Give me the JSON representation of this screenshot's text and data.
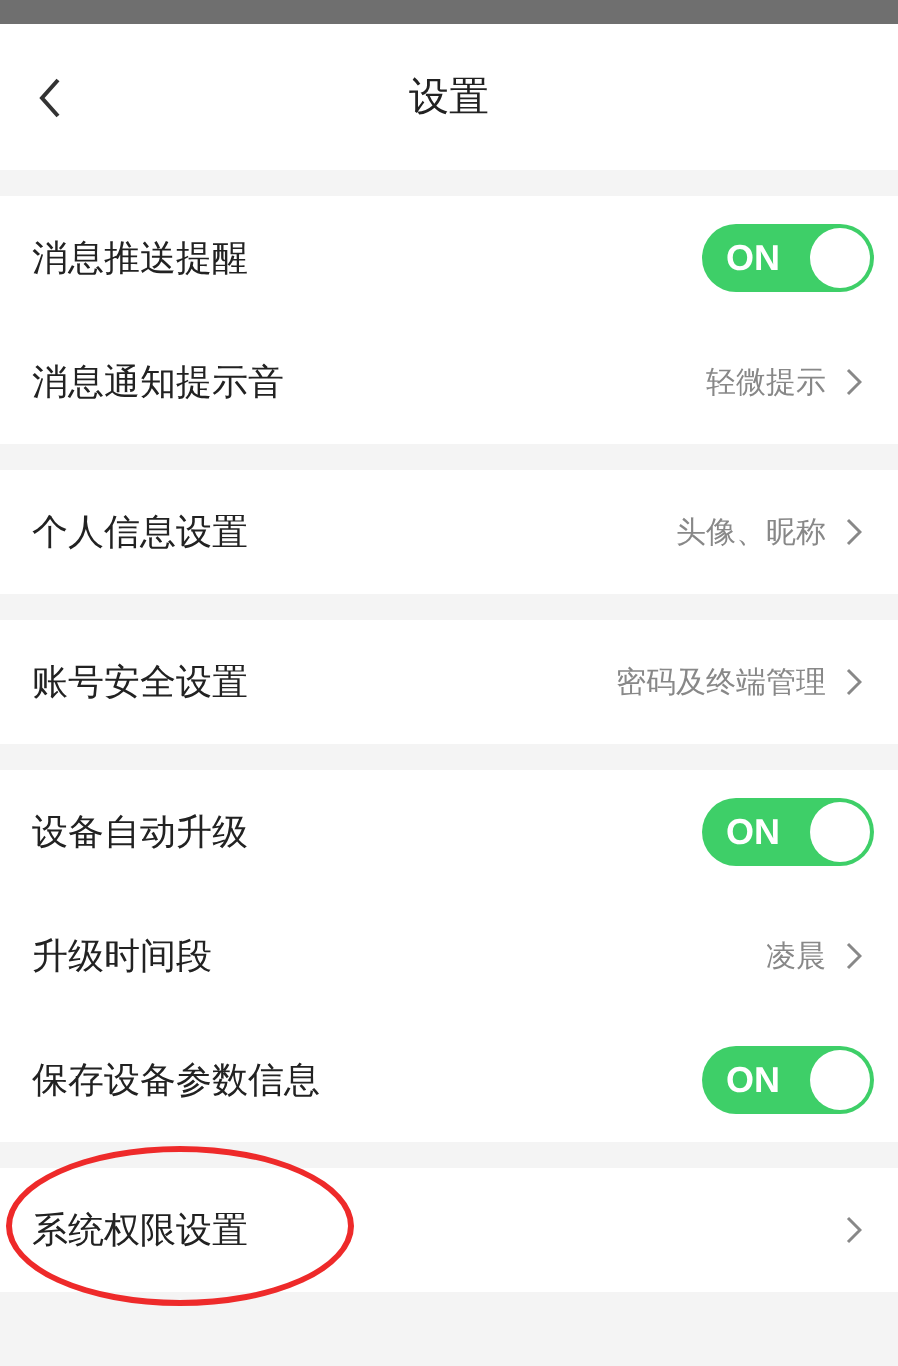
{
  "header": {
    "title": "设置"
  },
  "groups": [
    {
      "items": [
        {
          "kind": "toggle",
          "label": "消息推送提醒",
          "on": true,
          "toggle_text": "ON"
        },
        {
          "kind": "link",
          "label": "消息通知提示音",
          "detail": "轻微提示"
        }
      ]
    },
    {
      "items": [
        {
          "kind": "link",
          "label": "个人信息设置",
          "detail": "头像、昵称"
        }
      ]
    },
    {
      "items": [
        {
          "kind": "link",
          "label": "账号安全设置",
          "detail": "密码及终端管理"
        }
      ]
    },
    {
      "items": [
        {
          "kind": "toggle",
          "label": "设备自动升级",
          "on": true,
          "toggle_text": "ON"
        },
        {
          "kind": "link",
          "label": "升级时间段",
          "detail": "凌晨"
        },
        {
          "kind": "toggle",
          "label": "保存设备参数信息",
          "on": true,
          "toggle_text": "ON"
        }
      ]
    },
    {
      "items": [
        {
          "kind": "link",
          "label": "系统权限设置",
          "circled": true
        }
      ]
    }
  ]
}
